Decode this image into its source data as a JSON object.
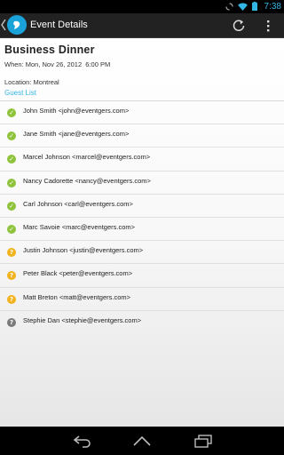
{
  "status_bar": {
    "time": "7:38",
    "icons": [
      "sync-icon",
      "wifi-icon",
      "battery-icon"
    ]
  },
  "action_bar": {
    "title": "Event Details",
    "app_icon": "app-logo-icon",
    "actions": [
      "refresh-icon",
      "overflow-menu-icon"
    ]
  },
  "event": {
    "title": "Business Dinner",
    "when": "When: Mon, Nov 26, 2012  6:00 PM",
    "location": "Location: Montreal"
  },
  "guest_list": {
    "header": "Guest List",
    "guests": [
      {
        "text": "John Smith <john@eventgers.com>",
        "status": "confirmed",
        "icon": "check-icon"
      },
      {
        "text": "Jane Smith <jane@eventgers.com>",
        "status": "confirmed",
        "icon": "check-icon"
      },
      {
        "text": "Marcel Johnson <marcel@eventgers.com>",
        "status": "confirmed",
        "icon": "check-icon"
      },
      {
        "text": "Nancy Cadorette <nancy@eventgers.com>",
        "status": "confirmed",
        "icon": "check-icon"
      },
      {
        "text": "Carl Johnson <carl@eventgers.com>",
        "status": "confirmed",
        "icon": "check-icon"
      },
      {
        "text": "Marc Savoie <marc@eventgers.com>",
        "status": "confirmed",
        "icon": "check-icon"
      },
      {
        "text": "Justin Johnson <justin@eventgers.com>",
        "status": "pending",
        "icon": "question-icon"
      },
      {
        "text": "Peter Black <peter@eventgers.com>",
        "status": "pending",
        "icon": "question-icon"
      },
      {
        "text": "Matt Breton <matt@eventgers.com>",
        "status": "pending",
        "icon": "question-icon"
      },
      {
        "text": "Stephie Dan <stephie@eventgers.com>",
        "status": "unknown",
        "icon": "question-icon"
      }
    ]
  },
  "nav_bar": {
    "buttons": [
      "back-icon",
      "home-icon",
      "recent-apps-icon"
    ]
  },
  "colors": {
    "accent": "#33b5e5",
    "confirmed": "#8fc33b",
    "pending": "#f2b21b",
    "unknown": "#7a7a7a"
  }
}
